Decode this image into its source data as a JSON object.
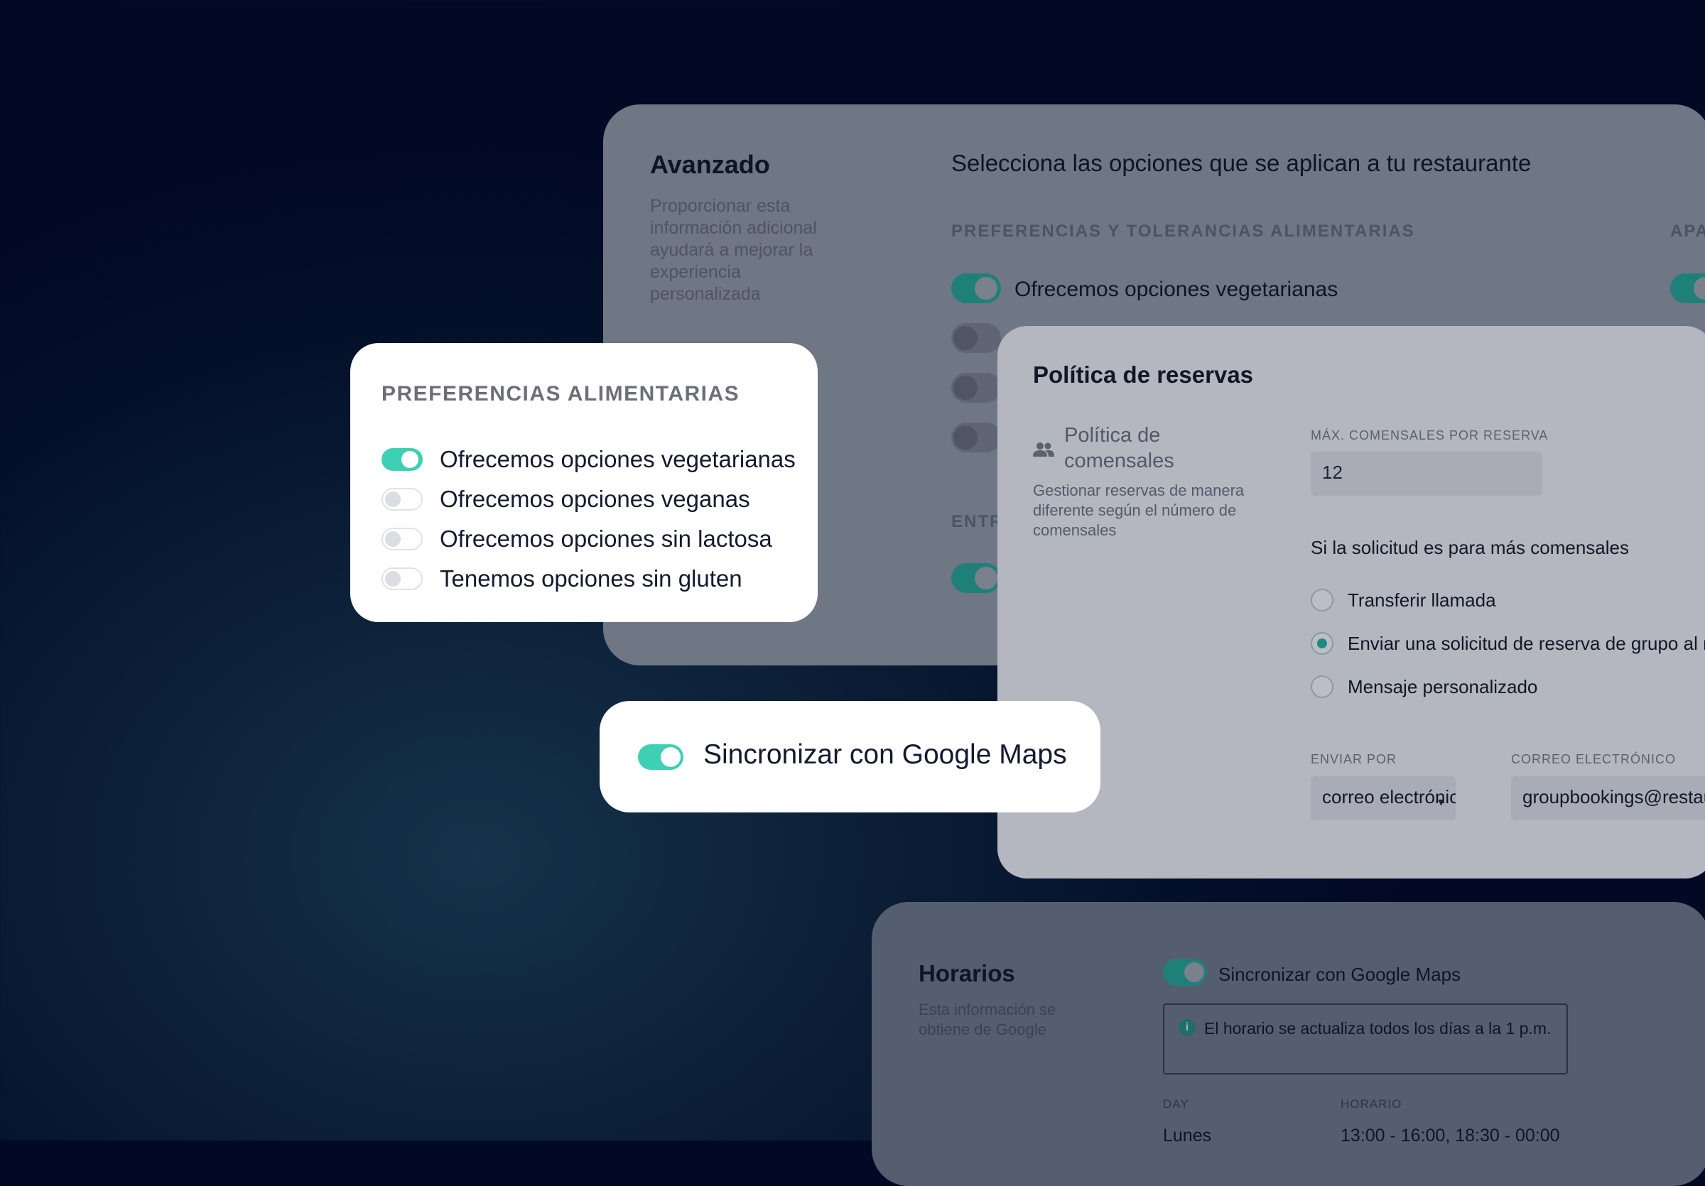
{
  "advanced": {
    "title": "Avanzado",
    "description": "Proporcionar esta información adicional ayudará a mejorar la experiencia personalizada",
    "heading": "Selecciona las opciones que se aplican a tu restaurante",
    "section_dietary": "PREFERENCIAS Y TOLERANCIAS ALIMENTARIAS",
    "section_right_partial": "APA",
    "section_entry_partial": "ENTR",
    "vegetarian_label": "Ofrecemos opciones vegetarianas"
  },
  "reservation_policy": {
    "title": "Política de reservas",
    "diners_title": "Política de comensales",
    "diners_description": "Gestionar reservas de manera diferente según el número de comensales",
    "max_label": "MÁX. COMENSALES POR RESERVA",
    "max_value": "12",
    "if_request": "Si la solicitud es para más comensales",
    "options": [
      {
        "label": "Transferir llamada",
        "selected": false
      },
      {
        "label": "Enviar una solicitud de reserva de grupo al r",
        "selected": true
      },
      {
        "label": "Mensaje personalizado",
        "selected": false
      }
    ],
    "send_by_label": "ENVIAR POR",
    "send_by_value": "correo electrónico",
    "email_label": "CORREO ELECTRÓNICO",
    "email_value": "groupbookings@restau"
  },
  "hours": {
    "title": "Horarios",
    "description": "Esta información se obtiene de Google",
    "sync_label": "Sincronizar con Google Maps",
    "sync_enabled": true,
    "info_text": "El horario se actualiza todos los días a la 1 p.m.",
    "col_day": "DAY",
    "col_hours": "HORARIO",
    "row_day": "Lunes",
    "row_hours": "13:00 - 16:00, 18:30 - 00:00"
  },
  "dietary_card": {
    "heading": "PREFERENCIAS ALIMENTARIAS",
    "items": [
      {
        "label": "Ofrecemos opciones vegetarianas",
        "enabled": true
      },
      {
        "label": "Ofrecemos opciones veganas",
        "enabled": false
      },
      {
        "label": "Ofrecemos opciones sin lactosa",
        "enabled": false
      },
      {
        "label": "Tenemos opciones sin gluten",
        "enabled": false
      }
    ]
  },
  "google_maps_card": {
    "label": "Sincronizar con Google Maps",
    "enabled": true
  },
  "colors": {
    "accent": "#3dd0b4",
    "accent_dark": "#1f8079",
    "background": "#04102a"
  }
}
